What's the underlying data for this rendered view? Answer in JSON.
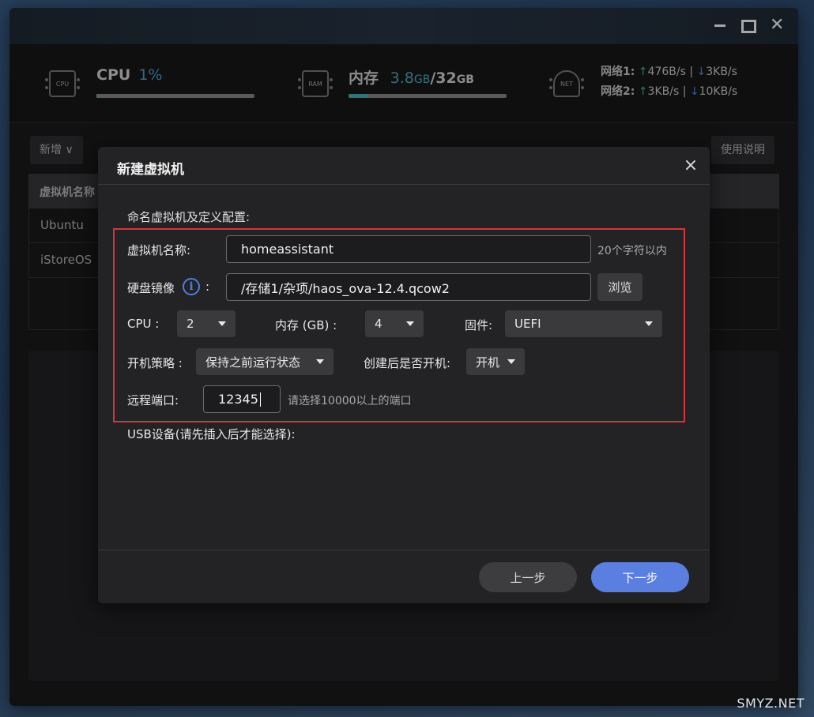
{
  "stats": {
    "cpu_chip_text": "CPU",
    "cpu_label": "CPU",
    "cpu_value": "1%",
    "cpu_fraction": 0.01,
    "ram_chip_text": "RAM",
    "mem_label": "内存",
    "mem_used": "3.8",
    "mem_used_unit": "GB",
    "mem_sep": "/",
    "mem_total": "32",
    "mem_total_unit": "GB",
    "mem_fraction": 0.12,
    "net_chip_text": "NET",
    "net1_label": "网络1:",
    "net1_up": "476B/s",
    "net1_down": "3KB/s",
    "net2_label": "网络2:",
    "net2_up": "3KB/s",
    "net2_down": "10KB/s",
    "up_arrow": "↑",
    "down_arrow": "↓",
    "net_sep": "|"
  },
  "toolbar": {
    "new_label": "新增 ∨",
    "help_label": "使用说明"
  },
  "table": {
    "header_name": "虚拟机名称",
    "rows": [
      "Ubuntu",
      "iStoreOS"
    ]
  },
  "modal": {
    "title": "新建虚拟机",
    "close_icon": "×",
    "section_heading": "命名虚拟机及定义配置:",
    "vm_name_label": "虚拟机名称:",
    "vm_name_value": "homeassistant",
    "vm_name_hint": "20个字符以内",
    "disk_label": "硬盘镜像",
    "disk_colon": ":",
    "info_icon_glyph": "i",
    "disk_value": "/存储1/杂项/haos_ova-12.4.qcow2",
    "browse_label": "浏览",
    "cpu_label": "CPU :",
    "cpu_value": "2",
    "mem_label": "内存 (GB) :",
    "mem_value": "4",
    "firmware_label": "固件:",
    "firmware_value": "UEFI",
    "boot_policy_label": "开机策略 :",
    "boot_policy_value": "保持之前运行状态",
    "autostart_label": "创建后是否开机:",
    "autostart_value": "开机",
    "port_label": "远程端口:",
    "port_value": "12345",
    "port_hint": "请选择10000以上的端口",
    "usb_label": "USB设备(请先插入后才能选择):",
    "prev_label": "上一步",
    "next_label": "下一步"
  },
  "watermark": "SMYZ.NET"
}
